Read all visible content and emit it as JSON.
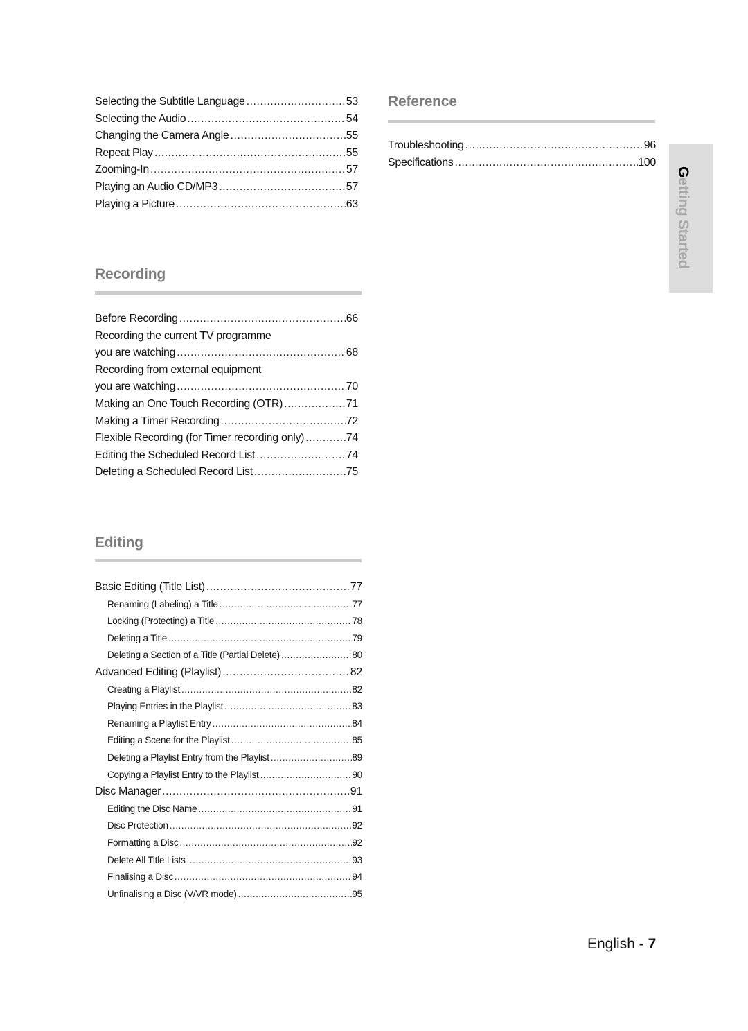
{
  "playback_continued": {
    "items": [
      {
        "label": "Selecting the Subtitle Language",
        "page": "53"
      },
      {
        "label": "Selecting the Audio",
        "page": "54"
      },
      {
        "label": "Changing the Camera Angle",
        "page": "55"
      },
      {
        "label": "Repeat Play",
        "page": "55"
      },
      {
        "label": "Zooming-In",
        "page": "57"
      },
      {
        "label": "Playing an Audio CD/MP3",
        "page": "57"
      },
      {
        "label": "Playing a Picture",
        "page": "63"
      }
    ]
  },
  "recording": {
    "title": "Recording",
    "items": [
      {
        "label": "Before Recording",
        "page": "66"
      },
      {
        "label": "Recording the current TV programme",
        "page": ""
      },
      {
        "label": "you are watching",
        "page": "68"
      },
      {
        "label": "Recording from external equipment",
        "page": ""
      },
      {
        "label": "you are watching",
        "page": "70"
      },
      {
        "label": "Making an One Touch Recording (OTR)",
        "page": "71"
      },
      {
        "label": "Making a Timer Recording",
        "page": "72"
      },
      {
        "label": "Flexible Recording (for Timer recording only)",
        "page": "74"
      },
      {
        "label": "Editing the Scheduled Record List",
        "page": "74"
      },
      {
        "label": "Deleting a Scheduled Record List",
        "page": "75"
      }
    ]
  },
  "editing": {
    "title": "Editing",
    "items": [
      {
        "label": "Basic Editing (Title List)",
        "page": "77",
        "level": 1
      },
      {
        "label": "Renaming (Labeling) a Title",
        "page": "77",
        "level": 2
      },
      {
        "label": "Locking (Protecting) a Title",
        "page": "78",
        "level": 2
      },
      {
        "label": "Deleting a Title",
        "page": "79",
        "level": 2
      },
      {
        "label": "Deleting a Section of a Title (Partial Delete)",
        "page": "80",
        "level": 2
      },
      {
        "label": "Advanced Editing (Playlist)",
        "page": "82",
        "level": 1
      },
      {
        "label": "Creating a Playlist",
        "page": "82",
        "level": 2
      },
      {
        "label": "Playing Entries in the Playlist",
        "page": "83",
        "level": 2
      },
      {
        "label": "Renaming a Playlist Entry",
        "page": "84",
        "level": 2
      },
      {
        "label": "Editing a Scene for the Playlist",
        "page": "85",
        "level": 2
      },
      {
        "label": "Deleting a Playlist Entry from the Playlist",
        "page": "89",
        "level": 2
      },
      {
        "label": "Copying a Playlist Entry to the Playlist",
        "page": "90",
        "level": 2
      },
      {
        "label": "Disc Manager",
        "page": "91",
        "level": 1
      },
      {
        "label": "Editing the Disc Name",
        "page": "91",
        "level": 2
      },
      {
        "label": "Disc Protection",
        "page": "92",
        "level": 2
      },
      {
        "label": "Formatting a Disc",
        "page": "92",
        "level": 2
      },
      {
        "label": "Delete All Title Lists",
        "page": "93",
        "level": 2
      },
      {
        "label": "Finalising a Disc",
        "page": "94",
        "level": 2
      },
      {
        "label": "Unfinalising a Disc (V/VR mode)",
        "page": "95",
        "level": 2
      }
    ]
  },
  "reference": {
    "title": "Reference",
    "items": [
      {
        "label": "Troubleshooting",
        "page": "96"
      },
      {
        "label": "Specifications",
        "page": "100"
      }
    ]
  },
  "side_tab": {
    "first_letter": "G",
    "rest": "etting Started"
  },
  "footer": {
    "language": "English",
    "separator": " - ",
    "page_number": "7"
  }
}
